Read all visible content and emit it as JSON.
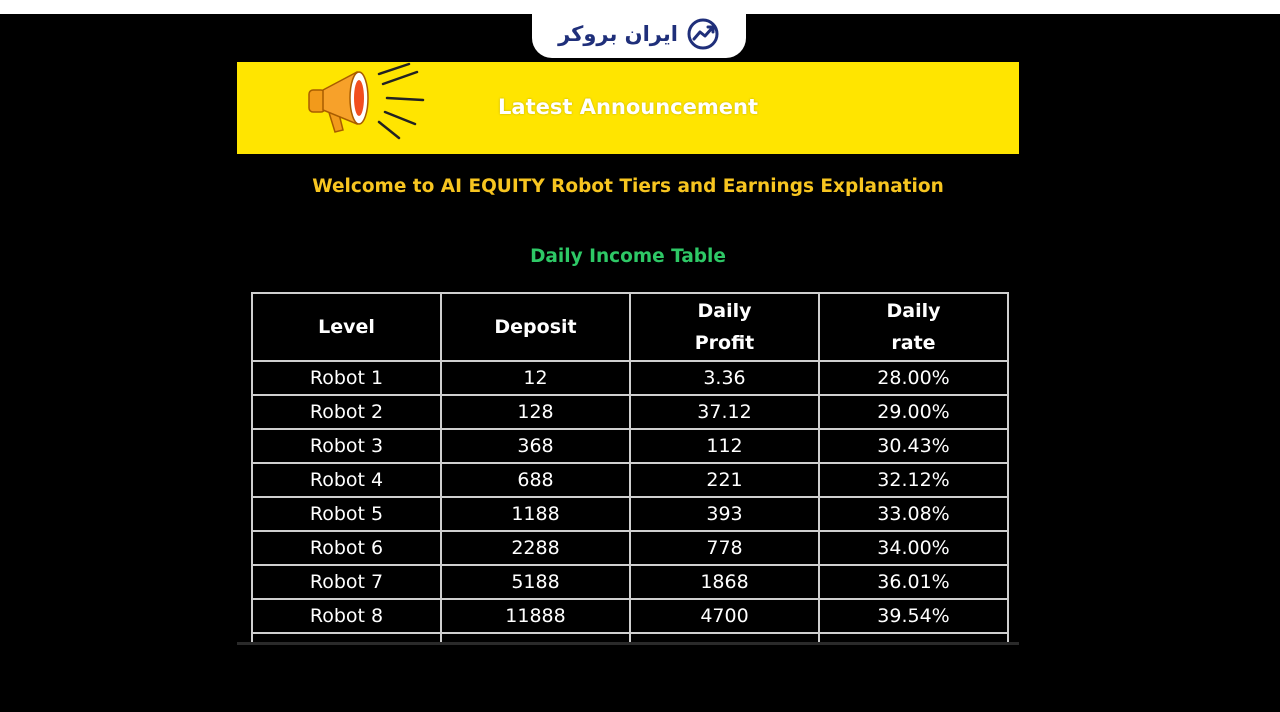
{
  "logo": {
    "text": "ایران بروکر",
    "icon": "trend-chart-icon"
  },
  "banner": {
    "title": "Latest Announcement",
    "icon": "megaphone-icon"
  },
  "welcome_text": "Welcome to AI EQUITY Robot Tiers and Earnings Explanation",
  "table_title": "Daily Income Table",
  "table": {
    "headers": [
      {
        "line1": "Level",
        "line2": ""
      },
      {
        "line1": "Deposit",
        "line2": ""
      },
      {
        "line1": "Daily",
        "line2": "Profit"
      },
      {
        "line1": "Daily",
        "line2": "rate"
      }
    ],
    "rows": [
      [
        "Robot 1",
        "12",
        "3.36",
        "28.00%"
      ],
      [
        "Robot 2",
        "128",
        "37.12",
        "29.00%"
      ],
      [
        "Robot 3",
        "368",
        "112",
        "30.43%"
      ],
      [
        "Robot 4",
        "688",
        "221",
        "32.12%"
      ],
      [
        "Robot 5",
        "1188",
        "393",
        "33.08%"
      ],
      [
        "Robot 6",
        "2288",
        "778",
        "34.00%"
      ],
      [
        "Robot 7",
        "5188",
        "1868",
        "36.01%"
      ],
      [
        "Robot 8",
        "11888",
        "4700",
        "39.54%"
      ]
    ]
  },
  "colors": {
    "banner": "#ffe500",
    "welcome": "#f7c520",
    "subtitle": "#2ec866",
    "logo_text": "#1f2f7a"
  }
}
